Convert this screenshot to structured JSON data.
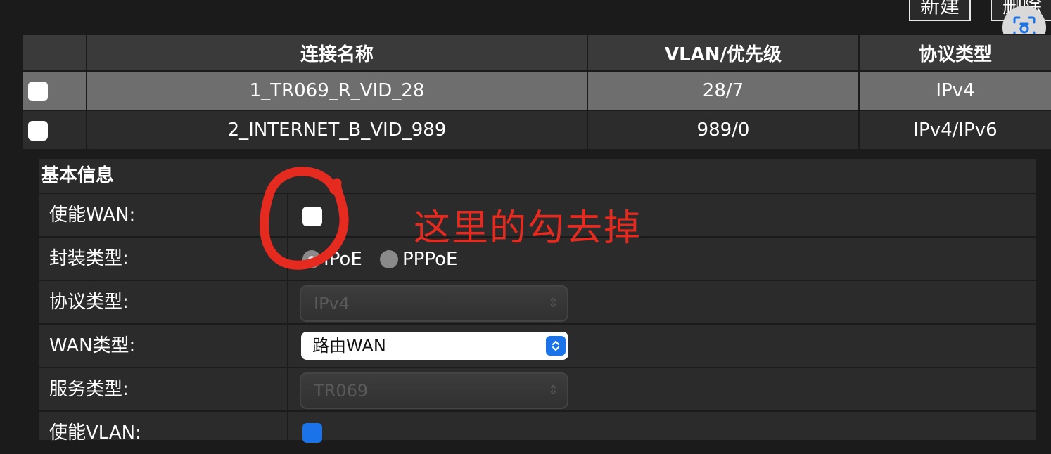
{
  "toolbar": {
    "new_label": "新建",
    "delete_label": "删除"
  },
  "connections": {
    "headers": [
      "",
      "连接名称",
      "VLAN/优先级",
      "协议类型"
    ],
    "rows": [
      {
        "name": "1_TR069_R_VID_28",
        "vlan": "28/7",
        "protocol": "IPv4"
      },
      {
        "name": "2_INTERNET_B_VID_989",
        "vlan": "989/0",
        "protocol": "IPv4/IPv6"
      }
    ]
  },
  "basic_info": {
    "title": "基本信息",
    "enable_wan_label": "使能WAN:",
    "encap_label": "封装类型:",
    "encap_options": [
      "IPoE",
      "PPPoE"
    ],
    "encap_selected": "IPoE",
    "protocol_label": "协议类型:",
    "protocol_value": "IPv4",
    "wan_type_label": "WAN类型:",
    "wan_type_value": "路由WAN",
    "service_label": "服务类型:",
    "service_value": "TR069",
    "enable_vlan_label": "使能VLAN:"
  },
  "annotation": {
    "text": "这里的勾去掉",
    "color": "#e52a20"
  },
  "icons": {
    "scan": "scan-icon"
  }
}
